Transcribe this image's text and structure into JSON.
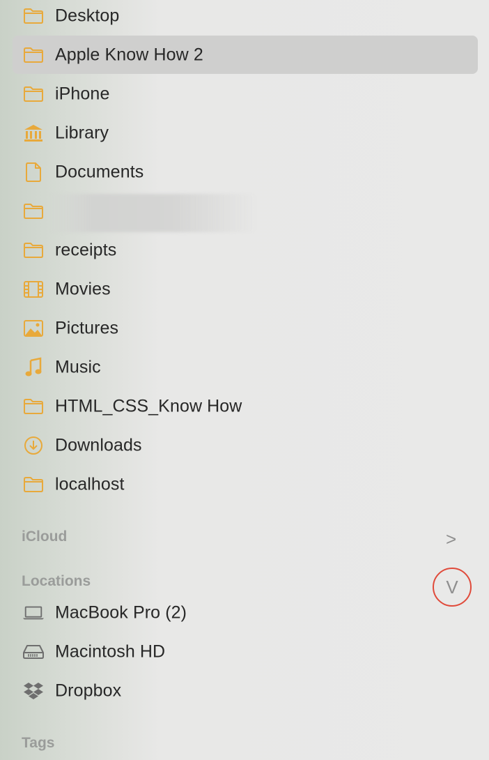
{
  "favorites": [
    {
      "label": "Desktop",
      "icon": "folder-icon",
      "selected": false
    },
    {
      "label": "Apple Know How 2",
      "icon": "folder-icon",
      "selected": true
    },
    {
      "label": "iPhone",
      "icon": "folder-icon",
      "selected": false
    },
    {
      "label": "Library",
      "icon": "library-icon",
      "selected": false
    },
    {
      "label": "Documents",
      "icon": "document-icon",
      "selected": false
    },
    {
      "label": "",
      "icon": "folder-icon",
      "selected": false
    },
    {
      "label": "receipts",
      "icon": "folder-icon",
      "selected": false
    },
    {
      "label": "Movies",
      "icon": "film-icon",
      "selected": false
    },
    {
      "label": "Pictures",
      "icon": "photo-icon",
      "selected": false
    },
    {
      "label": "Music",
      "icon": "music-note-icon",
      "selected": false
    },
    {
      "label": "HTML_CSS_Know How",
      "icon": "folder-icon",
      "selected": false
    },
    {
      "label": "Downloads",
      "icon": "download-icon",
      "selected": false
    },
    {
      "label": "localhost",
      "icon": "folder-icon",
      "selected": false
    }
  ],
  "icloud": {
    "title": "iCloud",
    "toggle": ">"
  },
  "locations": {
    "title": "Locations",
    "toggle": "V",
    "items": [
      {
        "label": "MacBook Pro (2)",
        "icon": "laptop-icon"
      },
      {
        "label": "Macintosh HD",
        "icon": "hard-drive-icon"
      },
      {
        "label": "Dropbox",
        "icon": "dropbox-icon"
      }
    ]
  },
  "tags": {
    "title": "Tags"
  },
  "colors": {
    "accent": "#e8a93b",
    "annotation": "#e04a3a",
    "device": "#6e6e6e"
  }
}
